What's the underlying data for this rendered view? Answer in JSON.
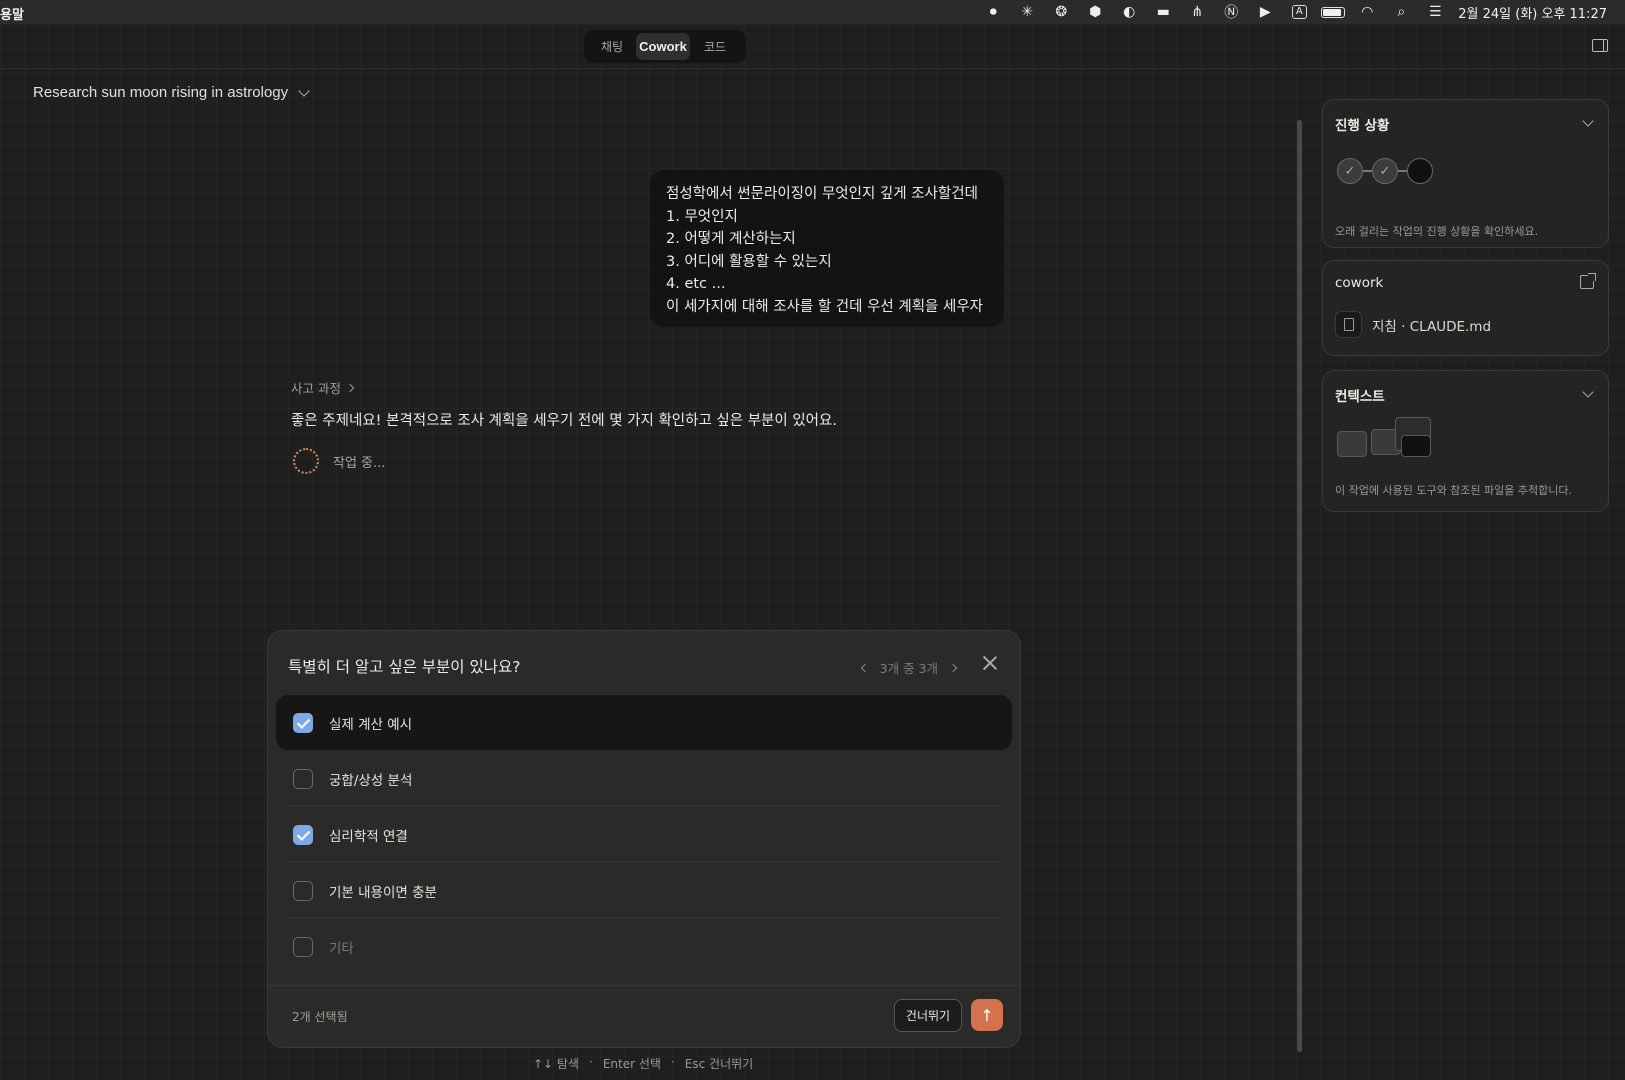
{
  "menubar": {
    "app_name": "용말",
    "input_indicator": "A",
    "clock": "2월 24일 (화) 오후 11:27"
  },
  "segmented": {
    "tabs": [
      {
        "label": "채팅"
      },
      {
        "label": "Cowork"
      },
      {
        "label": "코드"
      }
    ],
    "active": "Cowork"
  },
  "conversation": {
    "title": "Research sun moon rising in astrology",
    "user_message": [
      "점성학에서 썬문라이징이 무엇인지 깊게 조사할건데",
      "1. 무엇인지",
      "2. 어떻게 계산하는지",
      "3. 어디에 활용할 수 있는지",
      "4. etc ...",
      "이 세가지에 대해 조사를 할 건데 우선 계획을 세우자"
    ],
    "thinking_label": "사고 과정",
    "assistant_message": "좋은 주제네요! 본격적으로 조사 계획을 세우기 전에 몇 가지 확인하고 싶은 부분이 있어요.",
    "working_label": "작업 중..."
  },
  "question": {
    "title": "특별히 더 알고 싶은 부분이 있나요?",
    "pager": "3개 중 3개",
    "options": [
      {
        "label": "실제 계산 예시",
        "checked": true
      },
      {
        "label": "궁합/상성 분석",
        "checked": false
      },
      {
        "label": "심리학적 연결",
        "checked": true
      },
      {
        "label": "기본 내용이면 충분",
        "checked": false
      },
      {
        "label": "기타",
        "checked": false
      }
    ],
    "selected_count": "2개 선택됨",
    "skip_label": "건너뛰기",
    "send_icon": "arrow-up-icon"
  },
  "hints": {
    "navigate": "↑↓ 탐색",
    "select": "Enter 선택",
    "skip": "Esc 건너뛰기",
    "separator": "·"
  },
  "sidebar": {
    "progress": {
      "title": "진행 상황",
      "steps": [
        "done",
        "done",
        "current"
      ],
      "description": "오래 걸리는 작업의 진행 상황을 확인하세요."
    },
    "cowork": {
      "title": "cowork",
      "file": "지침 · CLAUDE.md"
    },
    "context": {
      "title": "컨텍스트",
      "description": "이 작업에 사용된 도구와 참조된 파일을 추적합니다."
    }
  },
  "colors": {
    "accent": "#d4714f",
    "checkbox": "#7fa9e6",
    "background": "#1f1f1e"
  }
}
